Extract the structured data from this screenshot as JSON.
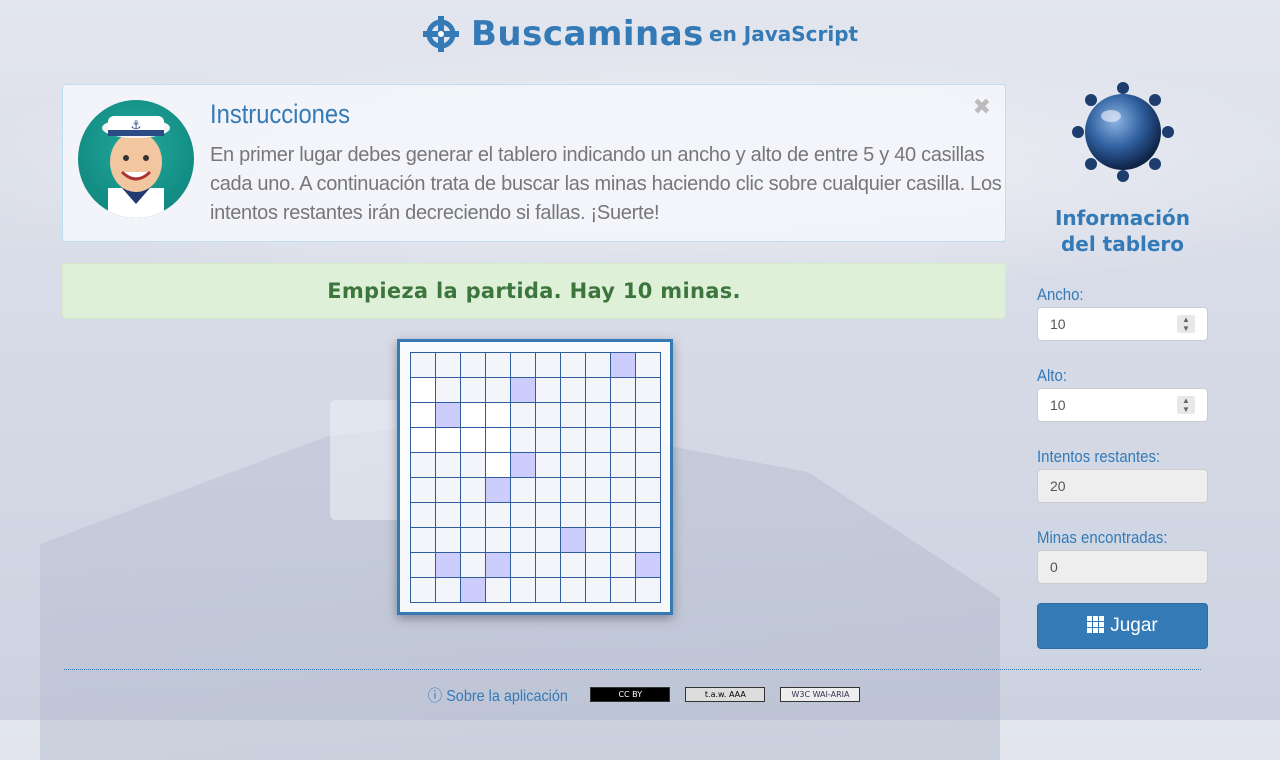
{
  "header": {
    "title": "Buscaminas",
    "subtitle": "en JavaScript"
  },
  "instructions": {
    "title": "Instrucciones",
    "text": "En primer lugar debes generar el tablero indicando un ancho y alto de entre 5 y 40 casillas cada uno. A continuación trata de buscar las minas haciendo clic sobre cualquier casilla. Los intentos restantes irán decreciendo si fallas. ¡Suerte!",
    "close": "✖"
  },
  "status": {
    "message": "Empieza la partida. Hay 10 minas."
  },
  "board": {
    "rows": 10,
    "cols": 10,
    "highlighted": [
      [
        0,
        8
      ],
      [
        1,
        4
      ],
      [
        2,
        1
      ],
      [
        4,
        4
      ],
      [
        5,
        3
      ],
      [
        7,
        6
      ],
      [
        8,
        1
      ],
      [
        8,
        3
      ],
      [
        8,
        9
      ],
      [
        9,
        2
      ]
    ],
    "white": [
      [
        2,
        2
      ],
      [
        2,
        3
      ],
      [
        3,
        0
      ],
      [
        3,
        1
      ],
      [
        3,
        2
      ],
      [
        3,
        3
      ],
      [
        4,
        3
      ],
      [
        1,
        0
      ],
      [
        2,
        0
      ]
    ]
  },
  "sidebar": {
    "title": "Información del tablero",
    "width_label": "Ancho:",
    "width_value": "10",
    "height_label": "Alto:",
    "height_value": "10",
    "attempts_label": "Intentos restantes:",
    "attempts_value": "20",
    "mines_label": "Minas encontradas:",
    "mines_value": "0",
    "play_label": "Jugar"
  },
  "footer": {
    "about": "Sobre la aplicación",
    "badges": [
      "CC BY",
      "t.a.w. AAA",
      "W3C WAI-ARIA"
    ]
  },
  "colors": {
    "primary": "#337ab7",
    "success_bg": "#dff0d8",
    "success_text": "#3c763d",
    "highlight_cell": "#cdcdfd"
  },
  "icons": {
    "title": "crosshair-icon",
    "play": "grid-icon",
    "about": "info-circle-icon",
    "close": "close-icon"
  }
}
